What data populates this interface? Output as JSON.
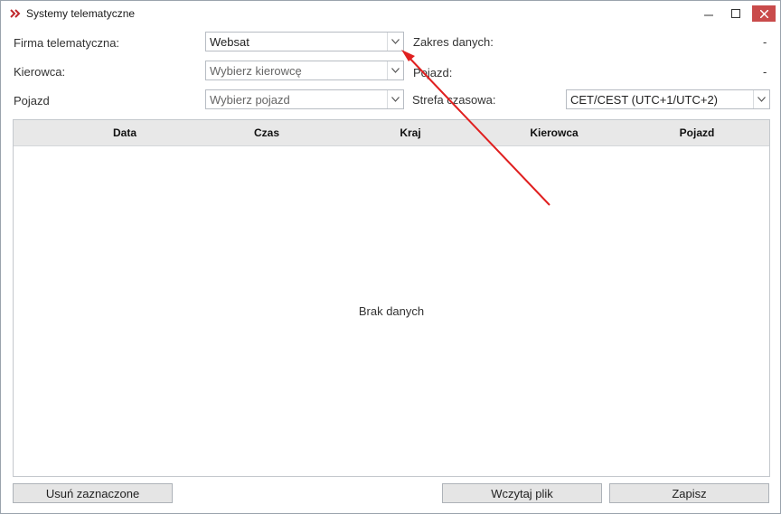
{
  "window": {
    "title": "Systemy telematyczne",
    "accent": "#c94b4b"
  },
  "form": {
    "firma_label": "Firma telematyczna:",
    "firma_value": "Websat",
    "kierowca_label": "Kierowca:",
    "kierowca_placeholder": "Wybierz kierowcę",
    "pojazd_label": "Pojazd",
    "pojazd_placeholder": "Wybierz pojazd",
    "zakres_label": "Zakres danych:",
    "zakres_value": "-",
    "pojazd_right_label": "Pojazd:",
    "pojazd_right_value": "-",
    "strefa_label": "Strefa czasowa:",
    "strefa_value": "CET/CEST (UTC+1/UTC+2)"
  },
  "table": {
    "columns": [
      "Data",
      "Czas",
      "Kraj",
      "Kierowca",
      "Pojazd"
    ],
    "empty_message": "Brak danych"
  },
  "buttons": {
    "delete_selected": "Usuń zaznaczone",
    "load_file": "Wczytaj plik",
    "save": "Zapisz"
  },
  "annotation": {
    "color": "#e02020"
  }
}
